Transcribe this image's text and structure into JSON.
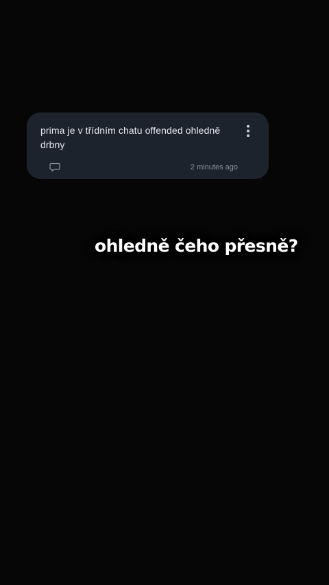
{
  "comment": {
    "text": "prima je v třídním chatu offended ohledně drbny",
    "timestamp": "2 minutes ago",
    "reply_icon": "speech-bubble-icon",
    "more_icon": "more-vertical-icon"
  },
  "caption": {
    "text": "ohledně čeho přesně?"
  },
  "colors": {
    "background": "#060606",
    "card": "#1c232c",
    "comment_text": "#e7eaee",
    "muted_text": "#8b939c",
    "caption_text": "#ffffff"
  }
}
